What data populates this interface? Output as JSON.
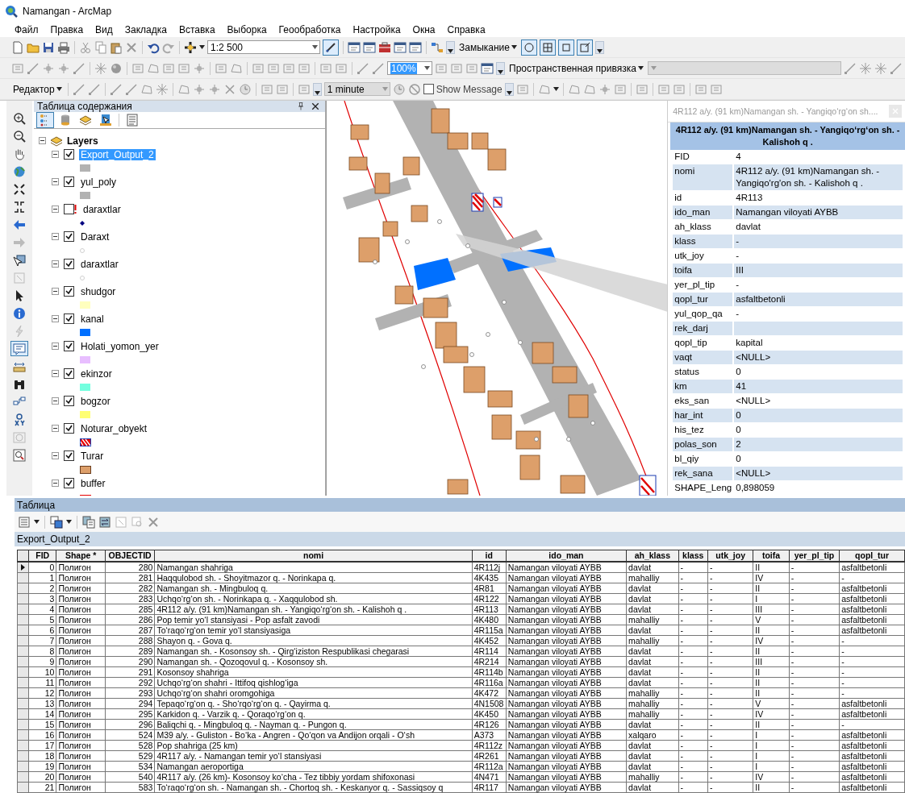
{
  "window": {
    "title": "Namangan - ArcMap"
  },
  "menu": [
    "Файл",
    "Правка",
    "Вид",
    "Закладка",
    "Вставка",
    "Выборка",
    "Геообработка",
    "Настройка",
    "Окна",
    "Справка"
  ],
  "toolbars": {
    "scale": "1:2 500",
    "snapping": "Замыкание",
    "snap_options": [
      {
        "on": true
      },
      {
        "on": true
      },
      {
        "on": true
      },
      {
        "on": true
      }
    ],
    "zoom_percent": "100%",
    "georeferencing": "Пространственная привязка",
    "editor": "Редактор",
    "time_step": "1 minute",
    "show_message": {
      "label": "Show Message",
      "checked": false
    }
  },
  "left_tools": [
    {
      "selected": false
    },
    {
      "selected": false
    },
    {
      "selected": false
    },
    {
      "selected": false
    },
    {
      "selected": false
    },
    {
      "selected": false
    },
    {
      "selected": false
    },
    {
      "selected": false
    },
    {
      "selected": false
    },
    {
      "selected": false
    },
    {
      "selected": false
    },
    {
      "selected": false
    },
    {
      "selected": false
    },
    {
      "selected": true
    },
    {
      "selected": false
    },
    {
      "selected": false
    },
    {
      "selected": false
    },
    {
      "selected": false
    },
    {
      "selected": false
    },
    {
      "selected": false
    }
  ],
  "toc": {
    "title": "Таблица содержания",
    "views": [
      {
        "selected": true
      },
      {
        "selected": false
      },
      {
        "selected": false
      },
      {
        "selected": false
      },
      {
        "selected": false
      }
    ],
    "root": "Layers",
    "layers": [
      {
        "name": "Export_Output_2",
        "checked": true,
        "selected": true,
        "warning": false,
        "kind": "fill",
        "color": "#b2b2b2"
      },
      {
        "name": "yul_poly",
        "checked": true,
        "selected": false,
        "warning": false,
        "kind": "fill",
        "color": "#b2b2b2"
      },
      {
        "name": "daraxtlar",
        "checked": false,
        "selected": false,
        "warning": true,
        "kind": "dot",
        "color": "#000080"
      },
      {
        "name": "Daraxt",
        "checked": true,
        "selected": false,
        "warning": false,
        "kind": "circle",
        "color": "#d0d0d0"
      },
      {
        "name": "daraxtlar",
        "checked": true,
        "selected": false,
        "warning": false,
        "kind": "circle",
        "color": "#d0d0d0"
      },
      {
        "name": "shudgor",
        "checked": true,
        "selected": false,
        "warning": false,
        "kind": "fill",
        "color": "#ffffbe"
      },
      {
        "name": "kanal",
        "checked": true,
        "selected": false,
        "warning": false,
        "kind": "fill",
        "color": "#0070ff"
      },
      {
        "name": "Holati_yomon_yer",
        "checked": true,
        "selected": false,
        "warning": false,
        "kind": "fill",
        "color": "#e8beff"
      },
      {
        "name": "ekinzor",
        "checked": true,
        "selected": false,
        "warning": false,
        "kind": "fill",
        "color": "#73ffdf"
      },
      {
        "name": "bogzor",
        "checked": true,
        "selected": false,
        "warning": false,
        "kind": "fill",
        "color": "#ffff73"
      },
      {
        "name": "Noturar_obyekt",
        "checked": true,
        "selected": false,
        "warning": false,
        "kind": "hatch",
        "color": "#e60000"
      },
      {
        "name": "Turar",
        "checked": true,
        "selected": false,
        "warning": false,
        "kind": "bordered",
        "color": "#dd9f6a"
      },
      {
        "name": "buffer",
        "checked": true,
        "selected": false,
        "warning": false,
        "kind": "outline",
        "color": "#e60000"
      }
    ]
  },
  "identify": {
    "title": "4R112 a/y. (91 km)Namangan sh. - Yangiqo‘rg‘on sh....",
    "heading": "4R112 a/y. (91 km)Namangan sh. - Yangiqo‘rg‘on sh. - Kalishoh q .",
    "fields": [
      {
        "name": "FID",
        "value": "4"
      },
      {
        "name": "nomi",
        "value": "4R112 a/y. (91 km)Namangan sh. - Yangiqo'rg'on sh. - Kalishoh q ."
      },
      {
        "name": "id",
        "value": "4R113"
      },
      {
        "name": "ido_man",
        "value": "Namangan viloyati AYBB"
      },
      {
        "name": "ah_klass",
        "value": "davlat"
      },
      {
        "name": "klass",
        "value": "-"
      },
      {
        "name": "utk_joy",
        "value": "-"
      },
      {
        "name": "toifa",
        "value": "III"
      },
      {
        "name": "yer_pl_tip",
        "value": "-"
      },
      {
        "name": "qopl_tur",
        "value": "asfaltbetonli"
      },
      {
        "name": "yul_qop_qa",
        "value": "-"
      },
      {
        "name": "rek_darj"
      },
      {
        "name": "qopl_tip",
        "value": "kapital"
      },
      {
        "name": "vaqt",
        "value": "<NULL>"
      },
      {
        "name": "status",
        "value": "0"
      },
      {
        "name": "km",
        "value": "41"
      },
      {
        "name": "eks_san",
        "value": "<NULL>"
      },
      {
        "name": "har_int",
        "value": "0"
      },
      {
        "name": "his_tez",
        "value": "0"
      },
      {
        "name": "polas_son",
        "value": "2"
      },
      {
        "name": "bl_qiy",
        "value": "0"
      },
      {
        "name": "rek_sana",
        "value": "<NULL>"
      },
      {
        "name": "SHAPE_Leng",
        "value": "0,898059"
      }
    ]
  },
  "table": {
    "title": "Таблица",
    "tab": "Export_Output_2",
    "columns": [
      "FID",
      "Shape *",
      "OBJECTID",
      "nomi",
      "id",
      "ido_man",
      "ah_klass",
      "klass",
      "utk_joy",
      "toifa",
      "yer_pl_tip",
      "qopl_tur"
    ],
    "rows": [
      {
        "current": true,
        "cells": [
          "0",
          "Полигон",
          "280",
          "Namangan shahriga",
          "4R112j",
          "Namangan viloyati AYBB",
          "davlat",
          "-",
          "-",
          "II",
          "-",
          "asfaltbetonli"
        ]
      },
      {
        "current": false,
        "cells": [
          "1",
          "Полигон",
          "281",
          "Haqqulobod sh. - Shoyitmazor q. - Norinkapa q.",
          "4K435",
          "Namangan viloyati AYBB",
          "mahalliy",
          "-",
          "-",
          "IV",
          "-",
          "-"
        ]
      },
      {
        "current": false,
        "cells": [
          "2",
          "Полигон",
          "282",
          "Namangan sh. - Mingbuloq q.",
          "4R81",
          "Namangan viloyati AYBB",
          "davlat",
          "-",
          "-",
          "II",
          "-",
          "asfaltbetonli"
        ]
      },
      {
        "current": false,
        "cells": [
          "3",
          "Полигон",
          "283",
          "Uchqo‘rg‘on sh. - Norinkapa q. - Xaqqulobod sh.",
          "4R122",
          "Namangan viloyati AYBB",
          "davlat",
          "-",
          "-",
          "I",
          "-",
          "asfaltbetonli"
        ]
      },
      {
        "current": false,
        "cells": [
          "4",
          "Полигон",
          "285",
          "4R112 a/y. (91 km)Namangan sh. - Yangiqo‘rg‘on sh. - Kalishoh q .",
          "4R113",
          "Namangan viloyati AYBB",
          "davlat",
          "-",
          "-",
          "III",
          "-",
          "asfaltbetonli"
        ]
      },
      {
        "current": false,
        "cells": [
          "5",
          "Полигон",
          "286",
          "Pop temir yo‘l stansiyasi - Pop asfalt zavodi",
          "4K480",
          "Namangan viloyati AYBB",
          "mahalliy",
          "-",
          "-",
          "V",
          "-",
          "asfaltbetonli"
        ]
      },
      {
        "current": false,
        "cells": [
          "6",
          "Полигон",
          "287",
          "To‘raqo‘rg‘on temir yo‘l stansiyasiga",
          "4R115a",
          "Namangan viloyati AYBB",
          "davlat",
          "-",
          "-",
          "II",
          "-",
          "asfaltbetonli"
        ]
      },
      {
        "current": false,
        "cells": [
          "7",
          "Полигон",
          "288",
          "Shayon q. - Gova q.",
          "4K452",
          "Namangan viloyati AYBB",
          "mahalliy",
          "-",
          "-",
          "IV",
          "-",
          "-"
        ]
      },
      {
        "current": false,
        "cells": [
          "8",
          "Полигон",
          "289",
          "Namangan sh. - Kosonsoy sh. - Qirg‘iziston Respublikasi chegarasi",
          "4R114",
          "Namangan viloyati AYBB",
          "davlat",
          "-",
          "-",
          "II",
          "-",
          "-"
        ]
      },
      {
        "current": false,
        "cells": [
          "9",
          "Полигон",
          "290",
          "Namangan sh. - Qozoqovul q. - Kosonsoy sh.",
          "4R214",
          "Namangan viloyati AYBB",
          "davlat",
          "-",
          "-",
          "III",
          "-",
          "-"
        ]
      },
      {
        "current": false,
        "cells": [
          "10",
          "Полигон",
          "291",
          "Kosonsoy shahriga",
          "4R114b",
          "Namangan viloyati AYBB",
          "davlat",
          "-",
          "-",
          "II",
          "-",
          "-"
        ]
      },
      {
        "current": false,
        "cells": [
          "11",
          "Полигон",
          "292",
          "Uchqo‘rg‘on shahri - Ittifoq qishlog‘iga",
          "4R116a",
          "Namangan viloyati AYBB",
          "davlat",
          "-",
          "-",
          "II",
          "-",
          "-"
        ]
      },
      {
        "current": false,
        "cells": [
          "12",
          "Полигон",
          "293",
          "Uchqo‘rg‘on shahri oromgohiga",
          "4K472",
          "Namangan viloyati AYBB",
          "mahalliy",
          "-",
          "-",
          "II",
          "-",
          "-"
        ]
      },
      {
        "current": false,
        "cells": [
          "13",
          "Полигон",
          "294",
          "Tepaqo‘rg‘on q. - Sho‘rqo‘rg‘on q. - Qayirma q.",
          "4N1508",
          "Namangan viloyati AYBB",
          "mahalliy",
          "-",
          "-",
          "V",
          "-",
          "asfaltbetonli"
        ]
      },
      {
        "current": false,
        "cells": [
          "14",
          "Полигон",
          "295",
          "Karkidon q. - Varzik q. - Qoraqo‘rg‘on q.",
          "4K450",
          "Namangan viloyati AYBB",
          "mahalliy",
          "-",
          "-",
          "IV",
          "-",
          "asfaltbetonli"
        ]
      },
      {
        "current": false,
        "cells": [
          "15",
          "Полигон",
          "296",
          "Baliqchi q. - Mingbuloq q. - Nayman q. - Pungon q.",
          "4R126",
          "Namangan viloyati AYBB",
          "davlat",
          "-",
          "-",
          "II",
          "-",
          "-"
        ]
      },
      {
        "current": false,
        "cells": [
          "16",
          "Полигон",
          "524",
          "M39 a/y. - Guliston - Bo‘ka - Angren - Qo‘qon va Andijon orqali - O‘sh",
          "A373",
          "Namangan viloyati AYBB",
          "xalqaro",
          "-",
          "-",
          "I",
          "-",
          "asfaltbetonli"
        ]
      },
      {
        "current": false,
        "cells": [
          "17",
          "Полигон",
          "528",
          "Pop shahriga (25 km)",
          "4R112z",
          "Namangan viloyati AYBB",
          "davlat",
          "-",
          "-",
          "I",
          "-",
          "asfaltbetonli"
        ]
      },
      {
        "current": false,
        "cells": [
          "18",
          "Полигон",
          "529",
          "4R117 a/y. - Namangan temir yo‘l stansiyasi",
          "4R261",
          "Namangan viloyati AYBB",
          "davlat",
          "-",
          "-",
          "I",
          "-",
          "asfaltbetonli"
        ]
      },
      {
        "current": false,
        "cells": [
          "19",
          "Полигон",
          "534",
          "Namangan aeroportiga",
          "4R112a",
          "Namangan viloyati AYBB",
          "davlat",
          "-",
          "-",
          "I",
          "-",
          "asfaltbetonli"
        ]
      },
      {
        "current": false,
        "cells": [
          "20",
          "Полигон",
          "540",
          "4R117 a/y. (26 km)- Kosonsoy ko‘cha - Tez tibbiy yordam shifoxonasi",
          "4N471",
          "Namangan viloyati AYBB",
          "mahalliy",
          "-",
          "-",
          "IV",
          "-",
          "asfaltbetonli"
        ]
      },
      {
        "current": false,
        "cells": [
          "21",
          "Полигон",
          "583",
          "To‘raqo‘rg‘on sh. - Namangan sh. - Chortoq sh. - Keskanyor q. - Sassiqsoy q",
          "4R117",
          "Namangan viloyati AYBB",
          "davlat",
          "-",
          "-",
          "II",
          "-",
          "asfaltbetonli"
        ]
      }
    ]
  }
}
